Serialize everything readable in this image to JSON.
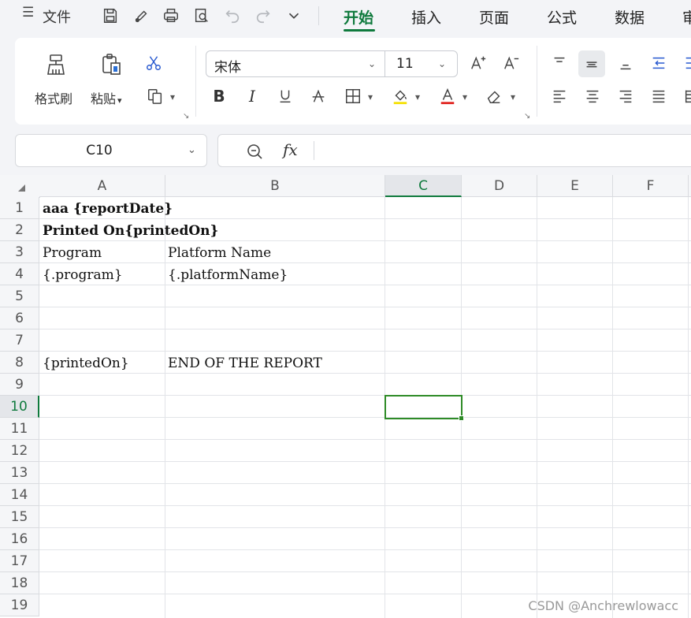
{
  "menu": {
    "file_label": "文件"
  },
  "tabs": [
    {
      "label": "开始",
      "active": true
    },
    {
      "label": "插入"
    },
    {
      "label": "页面"
    },
    {
      "label": "公式"
    },
    {
      "label": "数据"
    },
    {
      "label": "审"
    }
  ],
  "ribbon": {
    "format_painter_label": "格式刷",
    "paste_label": "粘贴",
    "font_name": "宋体",
    "font_size": "11",
    "highlight_color": "#f5e000",
    "font_color": "#e0201c"
  },
  "name_box": {
    "value": "C10"
  },
  "formula_bar": {
    "fx_label": "fx",
    "value": ""
  },
  "grid": {
    "columns": [
      "A",
      "B",
      "C",
      "D",
      "E",
      "F"
    ],
    "selected_column": "C",
    "rows": [
      "1",
      "2",
      "3",
      "4",
      "5",
      "6",
      "7",
      "8",
      "9",
      "10",
      "11",
      "12",
      "13",
      "14",
      "15",
      "16",
      "17",
      "18",
      "19"
    ],
    "selected_row": "10",
    "cells": {
      "A1": "aaa {reportDate}",
      "A2": "Printed On{printedOn}",
      "A3": "Program",
      "B3": "Platform Name",
      "A4": "{.program}",
      "B4": "{.platformName}",
      "A8": "{printedOn}",
      "B8": "END OF THE REPORT"
    }
  },
  "watermark": "CSDN @Anchrewlowacc",
  "colors": {
    "accent": "#0f7a3d",
    "selection_border": "#2e8b27"
  }
}
